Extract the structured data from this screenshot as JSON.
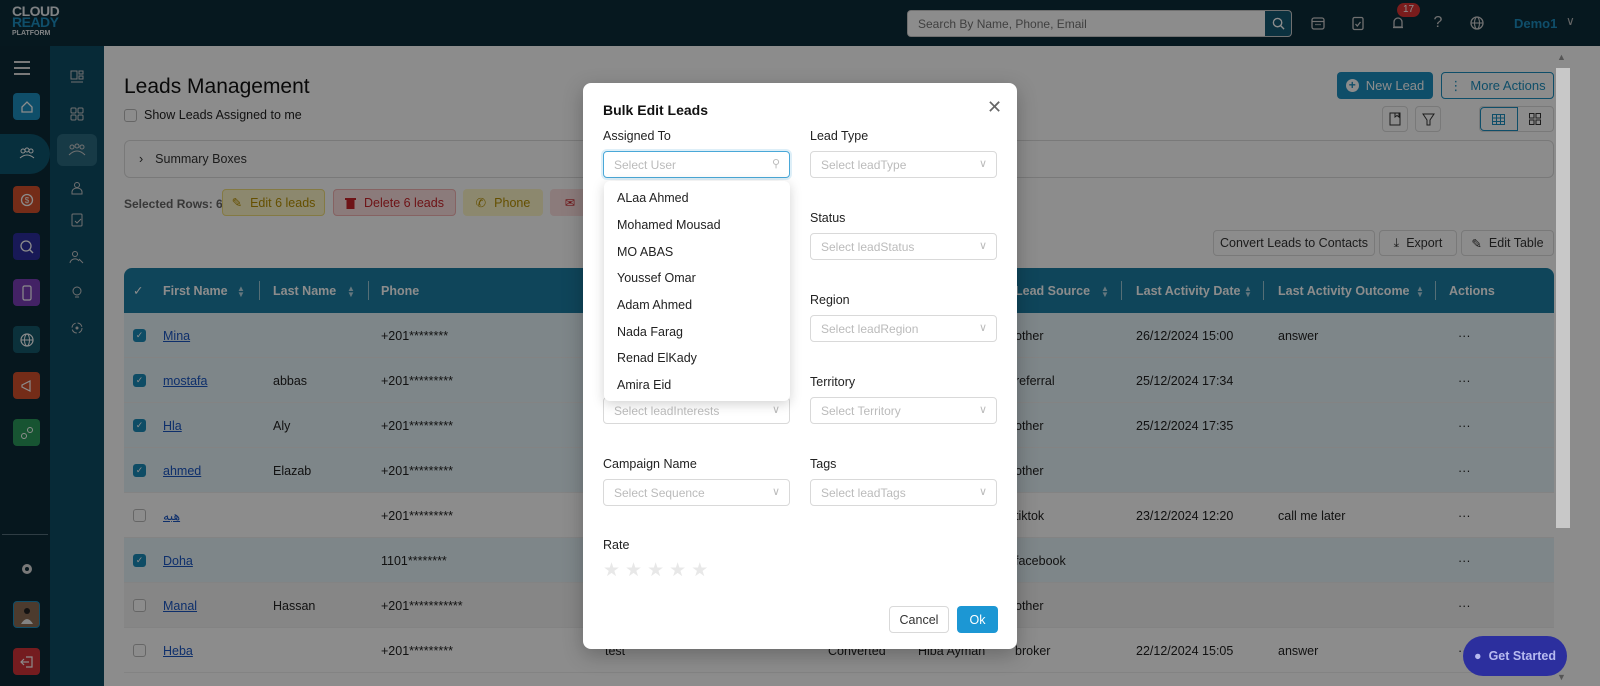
{
  "topbar": {
    "logo": {
      "line1": "CLOUD",
      "line2": "READY",
      "line3": "PLATFORM"
    },
    "search_placeholder": "Search By Name, Phone, Email",
    "notification_count": "17",
    "user_name": "Demo1"
  },
  "page": {
    "title": "Leads Management",
    "show_assigned_label": "Show Leads Assigned to me",
    "new_lead_label": "New Lead",
    "more_actions_label": "More Actions",
    "summary_label": "Summary Boxes",
    "selected_rows_label": "Selected Rows: 6",
    "edit_leads_label": "Edit 6 leads",
    "delete_leads_label": "Delete 6 leads",
    "phone_label": "Phone",
    "convert_label": "Convert Leads to Contacts",
    "export_label": "Export",
    "edit_table_label": "Edit Table"
  },
  "table": {
    "headers": [
      "First Name",
      "Last Name",
      "Phone",
      "Lead Source",
      "Last Activity Date",
      "Last Activity Outcome",
      "Actions"
    ],
    "rows": [
      {
        "checked": true,
        "first": "Mina",
        "last": "",
        "phone": "+201********",
        "mid1": "",
        "mid2": "",
        "source": "other",
        "date": "26/12/2024 15:00",
        "outcome": "answer",
        "actions": "···"
      },
      {
        "checked": true,
        "first": "mostafa",
        "last": "abbas",
        "phone": "+201*********",
        "mid1": "",
        "mid2": "",
        "source": "referral",
        "date": "25/12/2024 17:34",
        "outcome": "",
        "actions": "···"
      },
      {
        "checked": true,
        "first": "Hla",
        "last": "Aly",
        "phone": "+201*********",
        "mid1": "",
        "mid2": "",
        "source": "other",
        "date": "25/12/2024 17:35",
        "outcome": "",
        "actions": "···"
      },
      {
        "checked": true,
        "first": "ahmed",
        "last": "Elazab",
        "phone": "+201*********",
        "mid1": "",
        "mid2": "",
        "source": "other",
        "date": "",
        "outcome": "",
        "actions": "···"
      },
      {
        "checked": false,
        "first": "هبه",
        "last": "",
        "phone": "+201*********",
        "mid1": "",
        "mid2": "",
        "source": "tiktok",
        "date": "23/12/2024 12:20",
        "outcome": "call me later",
        "actions": "···"
      },
      {
        "checked": true,
        "first": "Doha",
        "last": "",
        "phone": "1101********",
        "mid1": "",
        "mid2": "",
        "source": "facebook",
        "date": "",
        "outcome": "",
        "actions": "···"
      },
      {
        "checked": false,
        "first": "Manal",
        "last": "Hassan",
        "phone": "+201***********",
        "mid1": "",
        "mid2": "",
        "source": "other",
        "date": "",
        "outcome": "",
        "actions": "···"
      },
      {
        "checked": false,
        "first": "Heba",
        "last": "",
        "phone": "+201*********",
        "mid1": "test",
        "mid2": "Converted",
        "mid3": "Hiba Ayman",
        "source": "broker",
        "date": "22/12/2024 15:05",
        "outcome": "answer",
        "actions": "···"
      }
    ]
  },
  "modal": {
    "title": "Bulk Edit Leads",
    "fields": {
      "assigned_to": {
        "label": "Assigned To",
        "placeholder": "Select User"
      },
      "lead_type": {
        "label": "Lead Type",
        "placeholder": "Select leadType"
      },
      "status": {
        "label": "Status",
        "placeholder": "Select leadStatus"
      },
      "region": {
        "label": "Region",
        "placeholder": "Select leadRegion"
      },
      "interests": {
        "placeholder": "Select leadInterests"
      },
      "territory": {
        "label": "Territory",
        "placeholder": "Select Territory"
      },
      "campaign": {
        "label": "Campaign Name",
        "placeholder": "Select Sequence"
      },
      "tags": {
        "label": "Tags",
        "placeholder": "Select leadTags"
      },
      "rate": {
        "label": "Rate",
        "value": 0,
        "max": 5
      }
    },
    "user_options": [
      "ALaa Ahmed",
      "Mohamed Mousad",
      "MO ABAS",
      "Youssef Omar",
      "Adam Ahmed",
      "Nada Farag",
      "Renad ElKady",
      "Amira Eid"
    ],
    "cancel_label": "Cancel",
    "ok_label": "Ok"
  },
  "get_started_label": "Get Started",
  "colors": {
    "primary": "#1c8fbf",
    "topbar": "#0c2c3a",
    "table_header": "#1c7fa4",
    "danger": "#c9242a",
    "warning": "#b89100"
  }
}
